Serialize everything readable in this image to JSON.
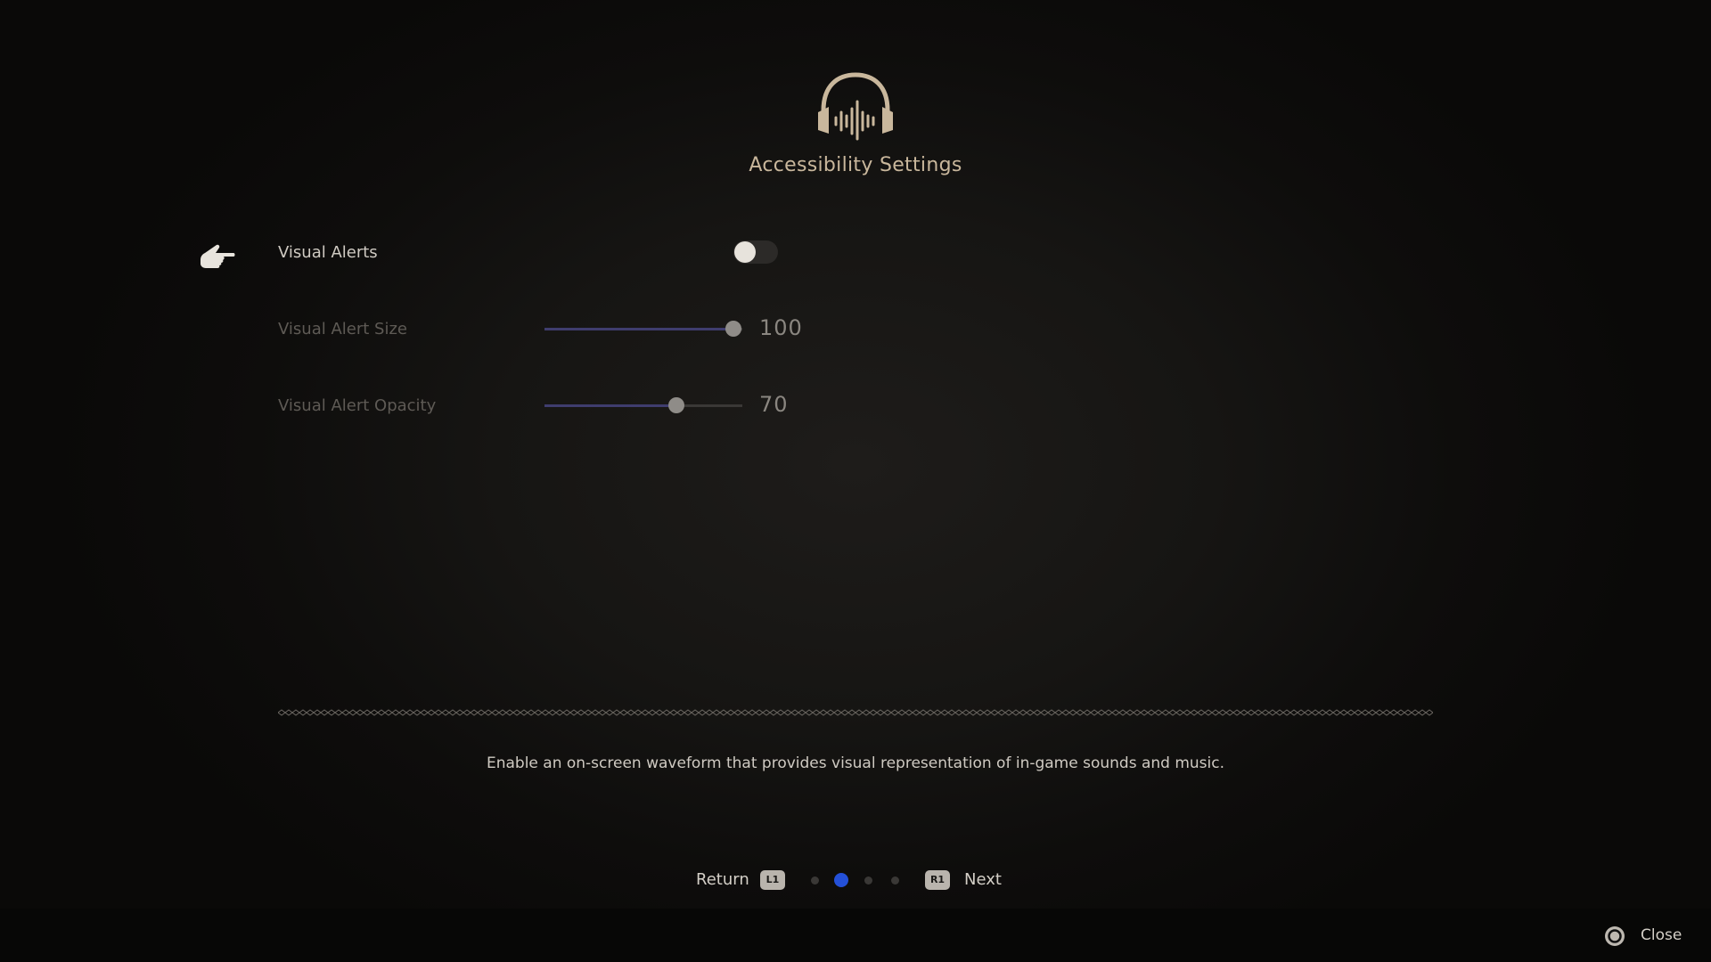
{
  "header": {
    "icon": "headphones-waveform-icon",
    "title": "Accessibility Settings"
  },
  "settings": {
    "visual_alerts": {
      "label": "Visual Alerts",
      "enabled": false
    },
    "visual_alert_size": {
      "label": "Visual Alert Size",
      "value": "100",
      "fraction": 1.0
    },
    "visual_alert_opacity": {
      "label": "Visual Alert Opacity",
      "value": "70",
      "fraction": 0.7
    }
  },
  "description": "Enable an on-screen waveform that provides visual representation of in-game sounds and music.",
  "nav": {
    "return_label": "Return",
    "return_button": "L1",
    "next_button": "R1",
    "next_label": "Next",
    "page_count": 4,
    "current_page": 2
  },
  "footer": {
    "close_label": "Close",
    "close_icon": "circle-button-icon"
  },
  "colors": {
    "title": "#c9b79c",
    "accent_blue": "#2450d8",
    "slider_fill": "#3f3d6e"
  }
}
